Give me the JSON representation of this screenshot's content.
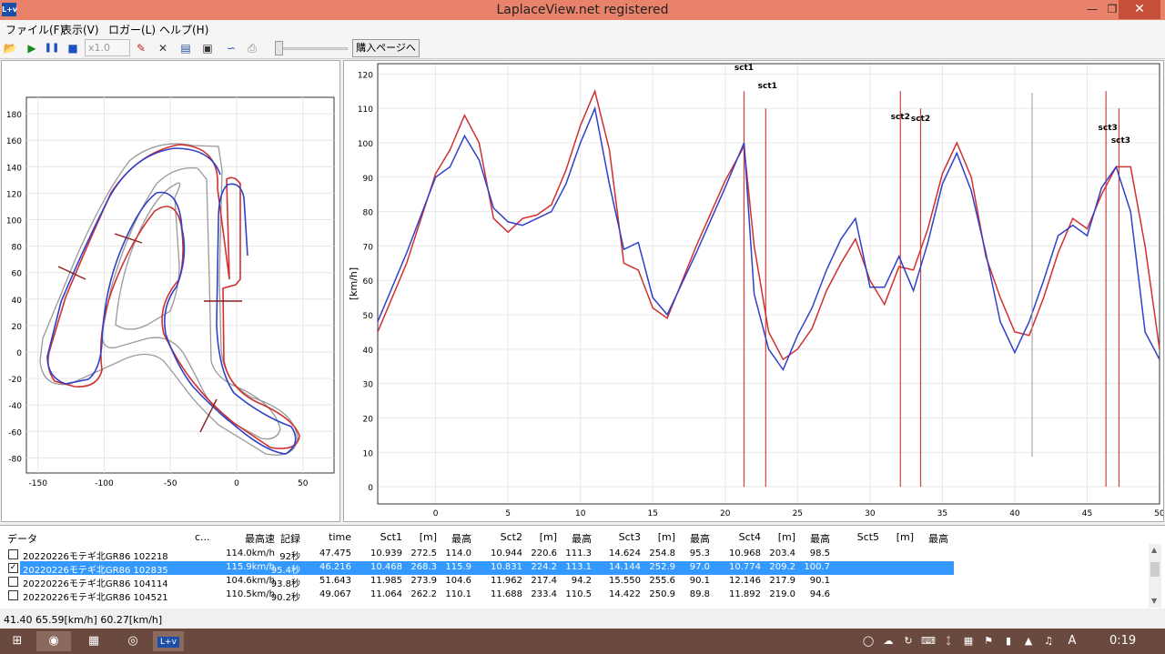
{
  "window": {
    "title": "LaplaceView.net registered",
    "icon_label": "L+v"
  },
  "menu": [
    "ファイル(F)",
    "表示(V)",
    "ロガー(L)",
    "ヘルプ(H)"
  ],
  "toolbar": {
    "speed_value": "x1.0",
    "buy_label": "購入ページへ"
  },
  "colors": {
    "lap_red": "#d03030",
    "lap_blue": "#3040c8",
    "selection": "#3399ff"
  },
  "track_map": {
    "x_ticks": [
      "-150",
      "-100",
      "-50",
      "0",
      "50"
    ],
    "y_ticks": [
      "180",
      "160",
      "140",
      "120",
      "100",
      "80",
      "60",
      "40",
      "20",
      "0",
      "-20",
      "-40",
      "-60",
      "-80"
    ]
  },
  "speed_chart": {
    "ylabel": "[km/h]",
    "y_ticks": [
      "120",
      "110",
      "100",
      "90",
      "80",
      "70",
      "60",
      "50",
      "40",
      "30",
      "20",
      "10",
      "0"
    ],
    "x_ticks": [
      "0",
      "5",
      "10",
      "15",
      "20",
      "25",
      "30",
      "35",
      "40",
      "45",
      "50"
    ],
    "sector_labels": [
      "sct1",
      "sct1",
      "sct2",
      "sct2",
      "sct3",
      "sct3"
    ]
  },
  "chart_data": {
    "type": "line",
    "xlabel": "",
    "ylabel": "[km/h]",
    "xlim": [
      -4,
      50
    ],
    "ylim": [
      -5,
      123
    ],
    "series": [
      {
        "x": [
          -4,
          -2,
          0,
          1,
          2,
          3,
          4,
          5,
          6,
          7,
          8,
          9,
          10,
          11,
          12,
          13,
          14,
          15,
          16,
          18,
          20,
          21.3,
          22,
          23,
          24,
          25,
          26,
          27,
          28,
          29,
          30,
          31,
          32,
          33,
          34,
          35,
          36,
          37,
          38,
          39,
          40,
          41,
          42,
          43,
          44,
          45,
          46,
          47,
          48,
          49,
          50
        ],
        "y": [
          45,
          65,
          91,
          98,
          108,
          100,
          78,
          74,
          78,
          79,
          82,
          92,
          105,
          115,
          98,
          65,
          63,
          52,
          49,
          70,
          89,
          99,
          70,
          45,
          37,
          40,
          46,
          57,
          65,
          72,
          60,
          53,
          64,
          63,
          75,
          91,
          100,
          90,
          67,
          55,
          45,
          44,
          55,
          68,
          78,
          75,
          85,
          93,
          93,
          70,
          40
        ]
      },
      {
        "x": [
          -4,
          -2,
          0,
          1,
          2,
          3,
          4,
          5,
          6,
          7,
          8,
          9,
          10,
          11,
          12,
          13,
          14,
          15,
          16,
          18,
          20,
          21.3,
          22,
          23,
          24,
          25,
          26,
          27,
          28,
          29,
          30,
          31,
          32,
          33,
          34,
          35,
          36,
          37,
          38,
          39,
          40,
          41,
          42,
          43,
          44,
          45,
          46,
          47,
          48,
          49,
          50
        ],
        "y": [
          48,
          68,
          90,
          93,
          102,
          95,
          81,
          77,
          76,
          78,
          80,
          88,
          100,
          110,
          88,
          69,
          71,
          55,
          50,
          68,
          87,
          100,
          56,
          40,
          34,
          44,
          52,
          63,
          72,
          78,
          58,
          58,
          67,
          57,
          71,
          88,
          97,
          86,
          68,
          48,
          39,
          48,
          60,
          73,
          76,
          73,
          87,
          93,
          80,
          45,
          37
        ]
      }
    ],
    "sector_lines": [
      {
        "label": "sct1",
        "x": 21.3
      },
      {
        "label": "sct1",
        "x": 22.8
      },
      {
        "label": "sct2",
        "x": 32.1
      },
      {
        "label": "sct2",
        "x": 33.5
      },
      {
        "label": "sct3",
        "x": 46.3
      },
      {
        "label": "sct3",
        "x": 47.2
      }
    ]
  },
  "table": {
    "headers": [
      "データ",
      "c...",
      "最高速",
      "記録",
      "time",
      "Sct1",
      "[m]",
      "最高",
      "Sct2",
      "[m]",
      "最高",
      "Sct3",
      "[m]",
      "最高",
      "Sct4",
      "[m]",
      "最高",
      "Sct5",
      "[m]",
      "最高"
    ],
    "rows": [
      {
        "checked": false,
        "selected": false,
        "cells": [
          "20220226モテギ北GR86 102218",
          "",
          "114.0km/h",
          "92秒",
          "47.475",
          "10.939",
          "272.5",
          "114.0",
          "10.944",
          "220.6",
          "111.3",
          "14.624",
          "254.8",
          "95.3",
          "10.968",
          "203.4",
          "98.5",
          "",
          "",
          ""
        ]
      },
      {
        "checked": true,
        "selected": true,
        "cells": [
          "20220226モテギ北GR86 102835",
          "",
          "115.9km/h",
          "95.4秒",
          "46.216",
          "10.468",
          "268.3",
          "115.9",
          "10.831",
          "224.2",
          "113.1",
          "14.144",
          "252.9",
          "97.0",
          "10.774",
          "209.2",
          "100.7",
          "",
          "",
          ""
        ]
      },
      {
        "checked": false,
        "selected": false,
        "cells": [
          "20220226モテギ北GR86 104114",
          "",
          "104.6km/h",
          "93.8秒",
          "51.643",
          "11.985",
          "273.9",
          "104.6",
          "11.962",
          "217.4",
          "94.2",
          "15.550",
          "255.6",
          "90.1",
          "12.146",
          "217.9",
          "90.1",
          "",
          "",
          ""
        ]
      },
      {
        "checked": false,
        "selected": false,
        "cells": [
          "20220226モテギ北GR86 104521",
          "",
          "110.5km/h",
          "90.2秒",
          "49.067",
          "11.064",
          "262.2",
          "110.1",
          "11.688",
          "233.4",
          "110.5",
          "14.422",
          "250.9",
          "89.8",
          "11.892",
          "219.0",
          "94.6",
          "",
          "",
          ""
        ]
      }
    ]
  },
  "status": "41.40 65.59[km/h] 60.27[km/h]",
  "taskbar": {
    "clock": "0:19",
    "ime": "A"
  }
}
